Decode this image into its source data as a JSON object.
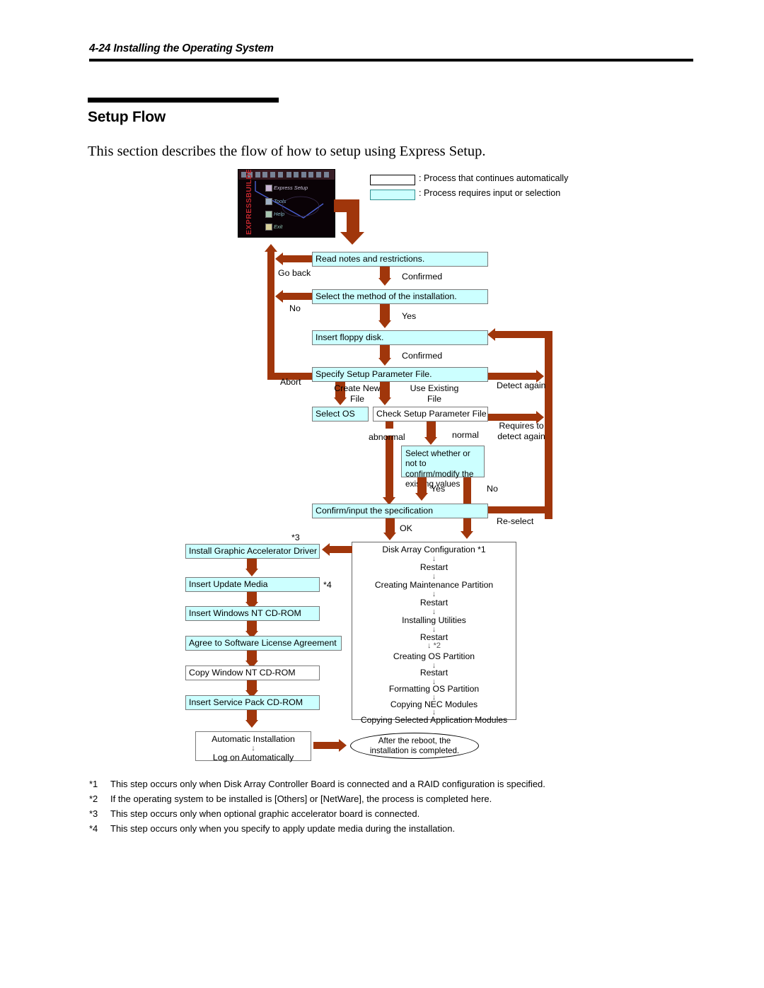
{
  "header": {
    "page_number": "4-24",
    "chapter_title": "Installing the Operating System"
  },
  "section": {
    "title": "Setup Flow",
    "intro": "This section describes the flow of how to setup using Express Setup."
  },
  "legend": [
    {
      "swatch": "white",
      "text": ": Process that continues automatically"
    },
    {
      "swatch": "cyan",
      "text": ": Process requires input or selection"
    }
  ],
  "expressbuilder": {
    "brand": "EXPRESSBUILDER",
    "menu": [
      "Express Setup",
      "Tools",
      "Help",
      "Exit"
    ]
  },
  "flow": {
    "read_notes": "Read notes and restrictions.",
    "select_method": "Select the method of the installation.",
    "insert_floppy": "Insert floppy disk.",
    "specify_param": "Specify Setup Parameter File.",
    "select_os": "Select OS",
    "check_param": "Check Setup Parameter File",
    "select_confirm": "Select whether or not to confirm/modify the existing values",
    "confirm_input": "Confirm/input the specification",
    "install_gfx": "Install Graphic Accelerator Driver",
    "insert_update": "Insert Update Media",
    "insert_ntcd": "Insert Windows NT CD-ROM",
    "agree_license": "Agree to Software License Agreement",
    "copy_ntcd": "Copy Window NT CD-ROM",
    "insert_sp": "Insert Service Pack CD-ROM",
    "auto_install_1": "Automatic Installation",
    "auto_install_arrow": "↓",
    "auto_install_2": "Log on Automatically"
  },
  "edge_labels": {
    "go_back": "Go back",
    "confirmed_1": "Confirmed",
    "no_1": "No",
    "yes_1": "Yes",
    "confirmed_2": "Confirmed",
    "abort": "Abort",
    "create_new_file": "Create New File",
    "use_existing_file": "Use Existing File",
    "detect_again": "Detect again",
    "requires_detect_again": "Requires to detect again",
    "abnormal": "abnormal",
    "normal": "normal",
    "yes_2": "Yes",
    "no_2": "No",
    "re_select": "Re-select",
    "ok": "OK",
    "ref_3": "*3",
    "ref_4": "*4"
  },
  "auto_panel": {
    "steps": [
      "Disk Array Configuration *1",
      "Restart",
      "Creating Maintenance Partition",
      "Restart",
      "Installing Utilities",
      "Restart",
      "Creating OS Partition",
      "Restart",
      "Formatting OS Partition",
      "Copying NEC Modules",
      "Copying Selected Application Modules"
    ],
    "arrow": "↓",
    "arrow_ref2": "↓ *2"
  },
  "terminator": {
    "line1": "After the reboot, the",
    "line2": "installation is completed."
  },
  "footnotes": [
    {
      "marker": "*1",
      "text": "This step occurs only when Disk Array Controller Board is connected and a RAID configuration is specified."
    },
    {
      "marker": "*2",
      "text": "If the operating system to be installed is [Others] or [NetWare], the process is completed here."
    },
    {
      "marker": "*3",
      "text": "This step occurs only when optional graphic accelerator board is connected."
    },
    {
      "marker": "*4",
      "text": "This step occurs only when you specify to apply update media during the installation."
    }
  ],
  "colors": {
    "process_input": "#ccffff",
    "arrow": "#a0360b",
    "rule": "#000000"
  }
}
